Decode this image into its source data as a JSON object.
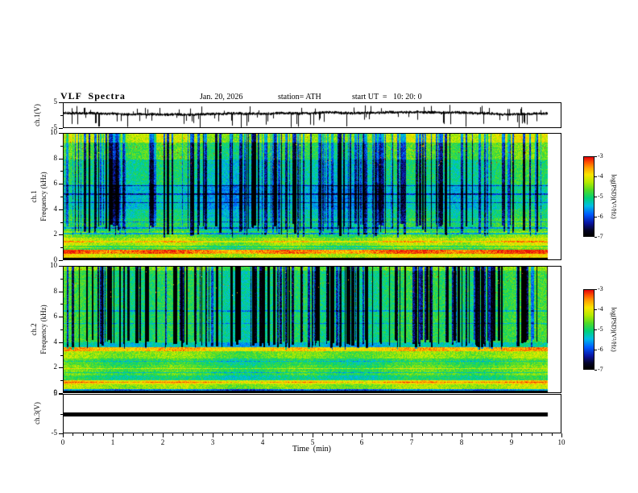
{
  "header": {
    "title": "VLF  Spectra",
    "date": "Jan. 20, 2026",
    "station": "station= ATH",
    "start_ut": "start UT  =   10: 20: 0"
  },
  "axes": {
    "x": {
      "label": "Time  (min)",
      "major": [
        0,
        1,
        2,
        3,
        4,
        5,
        6,
        7,
        8,
        9,
        10
      ],
      "range": [
        0,
        10
      ],
      "minor_per_major": 4
    }
  },
  "colorbar": {
    "label": "log(PSD)(V²/Hz)",
    "ticks": [
      -3,
      -4,
      -5,
      -6,
      -7
    ],
    "vtop": -3,
    "vbottom": -7
  },
  "chart_data": [
    {
      "panel": "ch1_waveform",
      "type": "line",
      "ylabel": "ch.1(V)",
      "ylim": [
        -5,
        5
      ],
      "yticks": [
        5,
        -5
      ],
      "x_range_min": [
        0,
        9.75
      ],
      "summary": "Dense noisy voltage trace centred near +1 V with frequent impulsive downward spikes reaching -5 V and occasional upward spikes to about +4 V",
      "gen": {
        "seed": 11,
        "base": 0.9,
        "jitter": 0.5,
        "spike_dn_p": 0.09,
        "spike_dn": [
          1.0,
          5.5
        ],
        "spike_up_p": 0.05,
        "spike_up": [
          0.8,
          2.8
        ]
      }
    },
    {
      "panel": "ch1_spectrogram",
      "type": "heatmap",
      "ylabel": "ch.1 Frequency (kHz)",
      "ylabel_line1": "ch.1",
      "ylabel_line2": "Frequency (kHz)",
      "ylim": [
        0,
        10
      ],
      "yticks": [
        10,
        8,
        6,
        4,
        2,
        0
      ],
      "value_range": [
        -7,
        -3
      ],
      "summary": "Broadband green/cyan PSD (~-5) with yellow band above 9.3 kHz, many dark-blue vertical dropouts above ~2.3 kHz, layered horizontal lines 1-3 kHz, strong red band 0.45-0.8 kHz (~-3.4) and black below 0.16 kHz",
      "gen": {
        "seed": 21,
        "noise": 0.38,
        "colmod": 0.6,
        "black_below": 0.16,
        "bands": [
          {
            "f0": 9.3,
            "f1": 10.01,
            "v": -4.25
          },
          {
            "f0": 8.0,
            "f1": 9.3,
            "v": -4.8
          },
          {
            "f0": 6.0,
            "f1": 8.0,
            "v": -5.15
          },
          {
            "f0": 4.0,
            "f1": 6.0,
            "v": -5.45
          },
          {
            "f0": 3.3,
            "f1": 4.0,
            "v": -5.2
          },
          {
            "f0": 2.3,
            "f1": 3.3,
            "v": -5.0
          },
          {
            "f0": 1.75,
            "f1": 2.3,
            "v": -4.7
          },
          {
            "f0": 1.15,
            "f1": 1.75,
            "v": -4.35
          },
          {
            "f0": 0.8,
            "f1": 1.15,
            "v": -4.9
          },
          {
            "f0": 0.45,
            "f1": 0.8,
            "v": -3.35
          },
          {
            "f0": 0.16,
            "f1": 0.45,
            "v": -4.1
          },
          {
            "f0": 0.0,
            "f1": 0.16,
            "v": -7.0
          }
        ],
        "hlines": [
          {
            "f": 5.9,
            "th": 0.12,
            "dv": -0.9
          },
          {
            "f": 5.25,
            "th": 0.12,
            "dv": -0.9
          },
          {
            "f": 4.55,
            "th": 0.1,
            "dv": -0.8
          },
          {
            "f": 3.0,
            "th": 0.1,
            "dv": -0.7
          },
          {
            "f": 2.55,
            "th": 0.1,
            "dv": -0.8
          },
          {
            "f": 2.1,
            "th": 0.1,
            "dv": -0.9
          },
          {
            "f": 1.45,
            "th": 0.08,
            "dv": 0.6
          },
          {
            "f": 0.95,
            "th": 0.06,
            "dv": 0.5
          }
        ],
        "streaks": {
          "count": 170,
          "fmin": 2.3,
          "fmin_jitter": 1.2,
          "depth": [
            0.6,
            2.2
          ],
          "max_width": 3
        },
        "speckle": {
          "prob": 0.004,
          "fmin": 7.3,
          "v": -3.3
        }
      }
    },
    {
      "panel": "ch2_spectrogram",
      "type": "heatmap",
      "ylabel": "ch.2 Frequency (kHz)",
      "ylabel_line1": "ch.2",
      "ylabel_line2": "Frequency (kHz)",
      "ylim": [
        0,
        10
      ],
      "yticks": [
        10,
        8,
        6,
        4,
        2,
        0
      ],
      "value_range": [
        -7,
        -3
      ],
      "summary": "Green background (~-5) with very dense deep-blue vertical dropouts above ~3.8 kHz, bright red/orange line 3.3-3.65 kHz (~-3.7), yellow-green layers 1-3.3 kHz, orange band 0.65-1 kHz and black below 0.16 kHz",
      "gen": {
        "seed": 33,
        "noise": 0.36,
        "colmod": 0.5,
        "black_below": 0.16,
        "bands": [
          {
            "f0": 9.7,
            "f1": 10.01,
            "v": -4.6
          },
          {
            "f0": 4.0,
            "f1": 9.7,
            "v": -5.0
          },
          {
            "f0": 3.65,
            "f1": 4.0,
            "v": -5.4
          },
          {
            "f0": 3.3,
            "f1": 3.65,
            "v": -3.7
          },
          {
            "f0": 2.75,
            "f1": 3.3,
            "v": -4.5
          },
          {
            "f0": 2.2,
            "f1": 2.75,
            "v": -4.9
          },
          {
            "f0": 1.35,
            "f1": 2.2,
            "v": -4.75
          },
          {
            "f0": 1.0,
            "f1": 1.35,
            "v": -5.1
          },
          {
            "f0": 0.65,
            "f1": 1.0,
            "v": -3.95
          },
          {
            "f0": 0.3,
            "f1": 0.65,
            "v": -4.4
          },
          {
            "f0": 0.16,
            "f1": 0.3,
            "v": -5.8
          },
          {
            "f0": 0.0,
            "f1": 0.16,
            "v": -7.0
          }
        ],
        "hlines": [
          {
            "f": 6.5,
            "th": 0.1,
            "dv": -0.6
          },
          {
            "f": 5.5,
            "th": 0.1,
            "dv": -0.6
          },
          {
            "f": 2.5,
            "th": 0.08,
            "dv": -0.5
          },
          {
            "f": 1.9,
            "th": 0.08,
            "dv": 0.55
          },
          {
            "f": 1.6,
            "th": 0.08,
            "dv": -0.6
          },
          {
            "f": 0.85,
            "th": 0.07,
            "dv": 0.5
          }
        ],
        "streaks": {
          "count": 190,
          "fmin": 3.8,
          "fmin_jitter": 0.8,
          "depth": [
            1.0,
            2.8
          ],
          "max_width": 3
        },
        "speckle": {
          "prob": 0.003,
          "fmin": 7.5,
          "v": -3.4
        }
      }
    },
    {
      "panel": "ch3_waveform",
      "type": "line",
      "ylabel": "ch.3(V)",
      "ylim": [
        -5,
        5
      ],
      "yticks": [
        5,
        -5
      ],
      "summary": "Flat saturated black trace at about -0.3 V for the whole record (no signal variation)",
      "gen": {
        "value": -0.3,
        "thickness_px": 5
      }
    }
  ]
}
